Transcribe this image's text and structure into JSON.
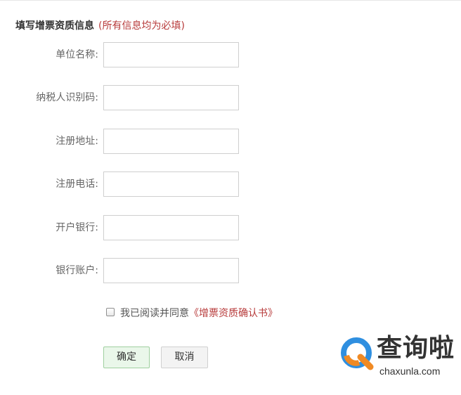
{
  "form": {
    "title": "填写增票资质信息",
    "note": "(所有信息均为必填)",
    "fields": [
      {
        "label": "单位名称:",
        "value": "",
        "placeholder": ""
      },
      {
        "label": "纳税人识别码:",
        "value": "",
        "placeholder": ""
      },
      {
        "label": "注册地址:",
        "value": "",
        "placeholder": ""
      },
      {
        "label": "注册电话:",
        "value": "",
        "placeholder": ""
      },
      {
        "label": "开户银行:",
        "value": "",
        "placeholder": ""
      },
      {
        "label": "银行账户:",
        "value": "",
        "placeholder": ""
      }
    ],
    "agree": {
      "checked": false,
      "text": "我已阅读并同意",
      "link": "《增票资质确认书》"
    },
    "buttons": {
      "confirm": "确定",
      "cancel": "取消"
    }
  },
  "watermark": {
    "title": "查询啦",
    "domain": "chaxunla.com"
  },
  "colors": {
    "accent_red": "#b73a3a",
    "confirm_bg": "#eaf7ea",
    "confirm_border": "#9fcf9f",
    "logo_blue": "#2f8fe0",
    "logo_orange": "#f08a24"
  },
  "icons": {
    "checkbox": "checkbox-unchecked-icon",
    "logo": "chaxunla-logo-icon"
  }
}
